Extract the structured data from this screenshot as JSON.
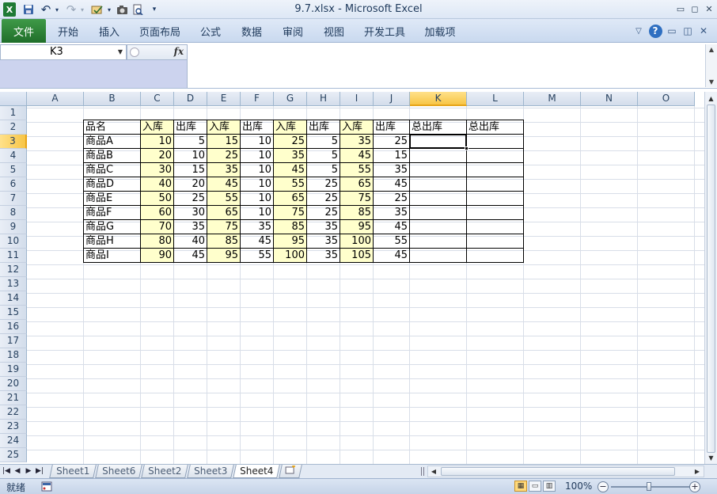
{
  "window": {
    "title": "9.7.xlsx  -  Microsoft Excel"
  },
  "quick_access": {
    "undo": "↶",
    "redo": "↷"
  },
  "ribbon": {
    "tabs": [
      "文件",
      "开始",
      "插入",
      "页面布局",
      "公式",
      "数据",
      "审阅",
      "视图",
      "开发工具",
      "加载项"
    ]
  },
  "formula_bar": {
    "name_box": "K3",
    "fx": "fx",
    "formula": ""
  },
  "grid": {
    "columns": [
      "A",
      "B",
      "C",
      "D",
      "E",
      "F",
      "G",
      "H",
      "I",
      "J",
      "K",
      "L",
      "M",
      "N",
      "O"
    ],
    "rows": [
      "1",
      "2",
      "3",
      "4",
      "5",
      "6",
      "7",
      "8",
      "9",
      "10",
      "11",
      "12",
      "13",
      "14",
      "15",
      "16",
      "17",
      "18",
      "19",
      "20",
      "21",
      "22",
      "23",
      "24",
      "25"
    ],
    "selected_cell": "K3",
    "header": [
      "品名",
      "入库",
      "出库",
      "入库",
      "出库",
      "入库",
      "出库",
      "入库",
      "出库",
      "总出库",
      "总出库"
    ],
    "data": [
      [
        "商品A",
        "10",
        "5",
        "15",
        "10",
        "25",
        "5",
        "35",
        "25"
      ],
      [
        "商品B",
        "20",
        "10",
        "25",
        "10",
        "35",
        "5",
        "45",
        "15"
      ],
      [
        "商品C",
        "30",
        "15",
        "35",
        "10",
        "45",
        "5",
        "55",
        "35"
      ],
      [
        "商品D",
        "40",
        "20",
        "45",
        "10",
        "55",
        "25",
        "65",
        "45"
      ],
      [
        "商品E",
        "50",
        "25",
        "55",
        "10",
        "65",
        "25",
        "75",
        "25"
      ],
      [
        "商品F",
        "60",
        "30",
        "65",
        "10",
        "75",
        "25",
        "85",
        "35"
      ],
      [
        "商品G",
        "70",
        "35",
        "75",
        "35",
        "85",
        "35",
        "95",
        "45"
      ],
      [
        "商品H",
        "80",
        "40",
        "85",
        "45",
        "95",
        "35",
        "100",
        "55"
      ],
      [
        "商品I",
        "90",
        "45",
        "95",
        "55",
        "100",
        "35",
        "105",
        "45"
      ]
    ]
  },
  "sheets": {
    "tabs": [
      "Sheet1",
      "Sheet6",
      "Sheet2",
      "Sheet3",
      "Sheet4"
    ],
    "active": "Sheet4"
  },
  "status": {
    "ready": "就绪",
    "zoom": "100%"
  },
  "colors": {
    "input_fill": "#ffffcc",
    "selection": "#f7c547",
    "file_tab": "#2d8a3a"
  }
}
